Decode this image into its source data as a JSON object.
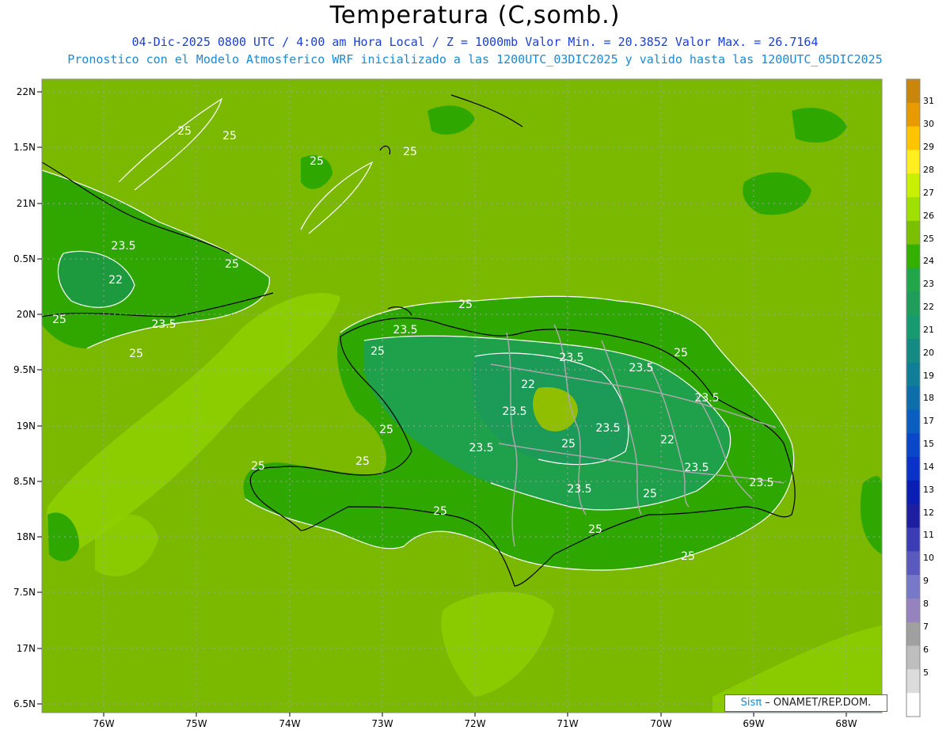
{
  "header": {
    "title": "Temperatura (C,somb.)",
    "line1": "04-Dic-2025  0800 UTC / 4:00 am Hora Local / Z = 1000mb   Valor Min. = 20.3852  Valor Max. = 26.7164",
    "line2": "Pronostico con el Modelo Atmosferico WRF inicializado a las 1200UTC_03DIC2025 y valido hasta las  1200UTC_05DIC2025"
  },
  "map": {
    "lat_labels": [
      "22N",
      "1.5N",
      "21N",
      "0.5N",
      "20N",
      "9.5N",
      "19N",
      "8.5N",
      "18N",
      "7.5N",
      "17N",
      "6.5N"
    ],
    "lon_labels": [
      "76W",
      "75W",
      "74W",
      "73W",
      "72W",
      "71W",
      "70W",
      "69W",
      "68W"
    ],
    "contour_labels": [
      "25",
      "25",
      "25",
      "25",
      "23.5",
      "22",
      "23.5",
      "25",
      "25",
      "25",
      "23.5",
      "25",
      "23.5",
      "22",
      "23.5",
      "23.5",
      "23.5",
      "25",
      "23.5",
      "22",
      "23.5",
      "23.5",
      "23.5",
      "23.5",
      "25",
      "25",
      "25",
      "25",
      "25",
      "25",
      "25",
      "25",
      "25"
    ]
  },
  "colorbar": {
    "ticks": [
      "31",
      "30",
      "29",
      "28",
      "27",
      "26",
      "25",
      "24",
      "23",
      "22",
      "21",
      "20",
      "19",
      "18",
      "17",
      "15",
      "14",
      "13",
      "12",
      "11",
      "10",
      "9",
      "8",
      "7",
      "6",
      "5"
    ],
    "colors": [
      "#c8870a",
      "#e89b00",
      "#ffc400",
      "#ffee20",
      "#c8f000",
      "#a0e000",
      "#7bc000",
      "#34b000",
      "#22a64a",
      "#1e9e5a",
      "#189a70",
      "#148a82",
      "#107e96",
      "#0d6eaa",
      "#0a5ec0",
      "#0a46c8",
      "#0a32c8",
      "#0a1eb4",
      "#1e1ea0",
      "#3c3cb4",
      "#5a5abe",
      "#7878c8",
      "#9682be",
      "#a0a0a0",
      "#bebebe",
      "#dcdcdc",
      "#ffffff"
    ]
  },
  "credit": {
    "brand": "Sisπ",
    "text": "– ONAMET/REP.DOM."
  }
}
